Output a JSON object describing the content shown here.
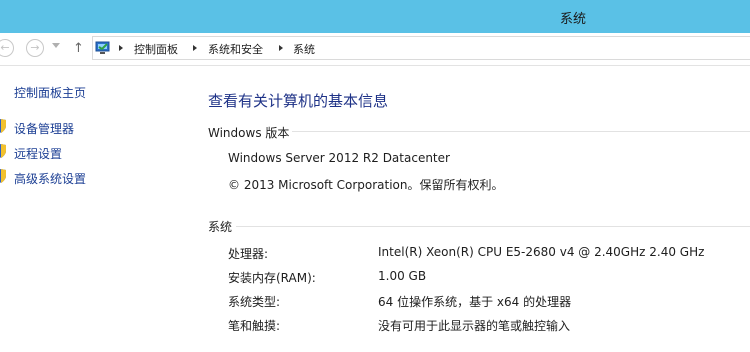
{
  "window": {
    "title": "系统"
  },
  "nav": {
    "breadcrumb": [
      "控制面板",
      "系统和安全",
      "系统"
    ]
  },
  "sidebar": {
    "home_label": "控制面板主页",
    "links": [
      {
        "label": "设备管理器",
        "icon": "shield-icon"
      },
      {
        "label": "远程设置",
        "icon": "shield-icon"
      },
      {
        "label": "高级系统设置",
        "icon": "shield-icon"
      }
    ]
  },
  "main": {
    "heading": "查看有关计算机的基本信息",
    "edition": {
      "section_title": "Windows 版本",
      "name": "Windows Server 2012 R2 Datacenter",
      "copyright": "© 2013 Microsoft Corporation。保留所有权利。"
    },
    "system": {
      "section_title": "系统",
      "rows": [
        {
          "label": "处理器:",
          "value": "Intel(R) Xeon(R) CPU E5-2680 v4 @ 2.40GHz   2.40 GHz"
        },
        {
          "label": "安装内存(RAM):",
          "value": "1.00 GB"
        },
        {
          "label": "系统类型:",
          "value": "64 位操作系统，基于 x64 的处理器"
        },
        {
          "label": "笔和触摸:",
          "value": "没有可用于此显示器的笔或触控输入"
        }
      ]
    }
  },
  "colors": {
    "titlebar": "#5ac1e6",
    "link": "#1c3f94",
    "heading": "#1e3287"
  }
}
